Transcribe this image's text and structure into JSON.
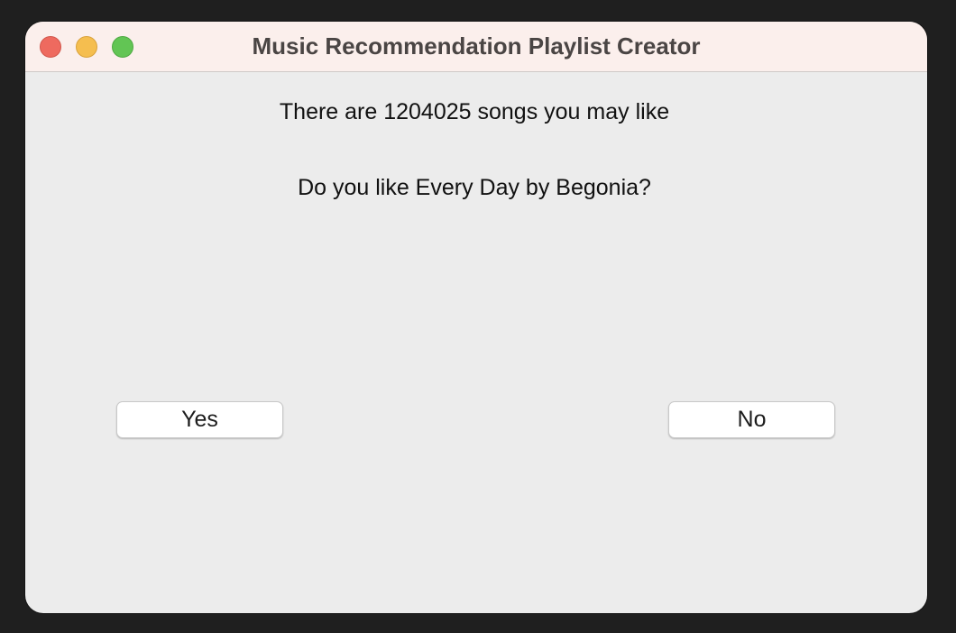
{
  "window": {
    "title": "Music Recommendation Playlist Creator"
  },
  "content": {
    "song_count_text": "There are 1204025 songs you may like",
    "question_text": "Do you like Every Day by Begonia?"
  },
  "buttons": {
    "yes_label": "Yes",
    "no_label": "No"
  },
  "colors": {
    "titlebar": "#fbefec",
    "window_bg": "#ececec",
    "close": "#ee6a5f",
    "minimize": "#f5be4f",
    "maximize": "#62c554"
  }
}
